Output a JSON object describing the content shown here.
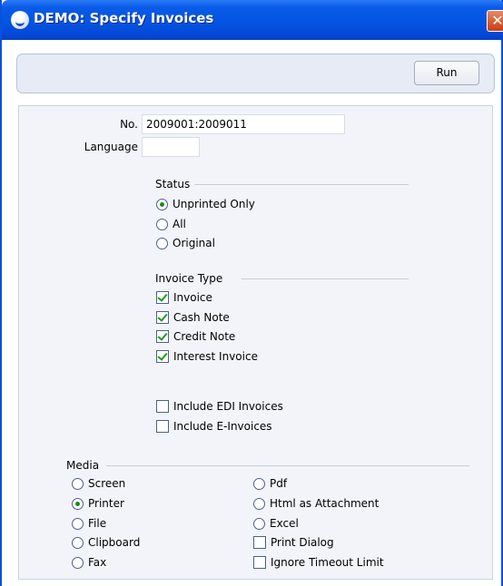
{
  "window": {
    "title": "DEMO: Specify Invoices",
    "close_glyph": "✕"
  },
  "toolbar": {
    "run_label": "Run"
  },
  "form": {
    "no_label": "No.",
    "no_value": "2009001:2009011",
    "language_label": "Language",
    "language_value": ""
  },
  "status": {
    "title": "Status",
    "options": [
      {
        "label": "Unprinted Only",
        "selected": true
      },
      {
        "label": "All",
        "selected": false
      },
      {
        "label": "Original",
        "selected": false
      }
    ]
  },
  "invoice_type": {
    "title": "Invoice Type",
    "options": [
      {
        "label": "Invoice",
        "checked": true
      },
      {
        "label": "Cash Note",
        "checked": true
      },
      {
        "label": "Credit Note",
        "checked": true
      },
      {
        "label": "Interest Invoice",
        "checked": true
      }
    ]
  },
  "extras": {
    "options": [
      {
        "label": "Include EDI Invoices",
        "checked": false
      },
      {
        "label": "Include E-Invoices",
        "checked": false
      }
    ]
  },
  "media": {
    "title": "Media",
    "left": [
      {
        "label": "Screen",
        "selected": false
      },
      {
        "label": "Printer",
        "selected": true
      },
      {
        "label": "File",
        "selected": false
      },
      {
        "label": "Clipboard",
        "selected": false
      },
      {
        "label": "Fax",
        "selected": false
      }
    ],
    "right": [
      {
        "label": "Pdf",
        "selected": false
      },
      {
        "label": "Html as Attachment",
        "selected": false
      },
      {
        "label": "Excel",
        "selected": false
      }
    ],
    "checks": [
      {
        "label": "Print Dialog",
        "checked": false
      },
      {
        "label": "Ignore Timeout Limit",
        "checked": false
      }
    ]
  },
  "colors": {
    "titlebar": "#0554e3",
    "panel": "#f2f4fa",
    "toolbar": "#e6ebf5",
    "check_green": "#1e9b1e"
  }
}
